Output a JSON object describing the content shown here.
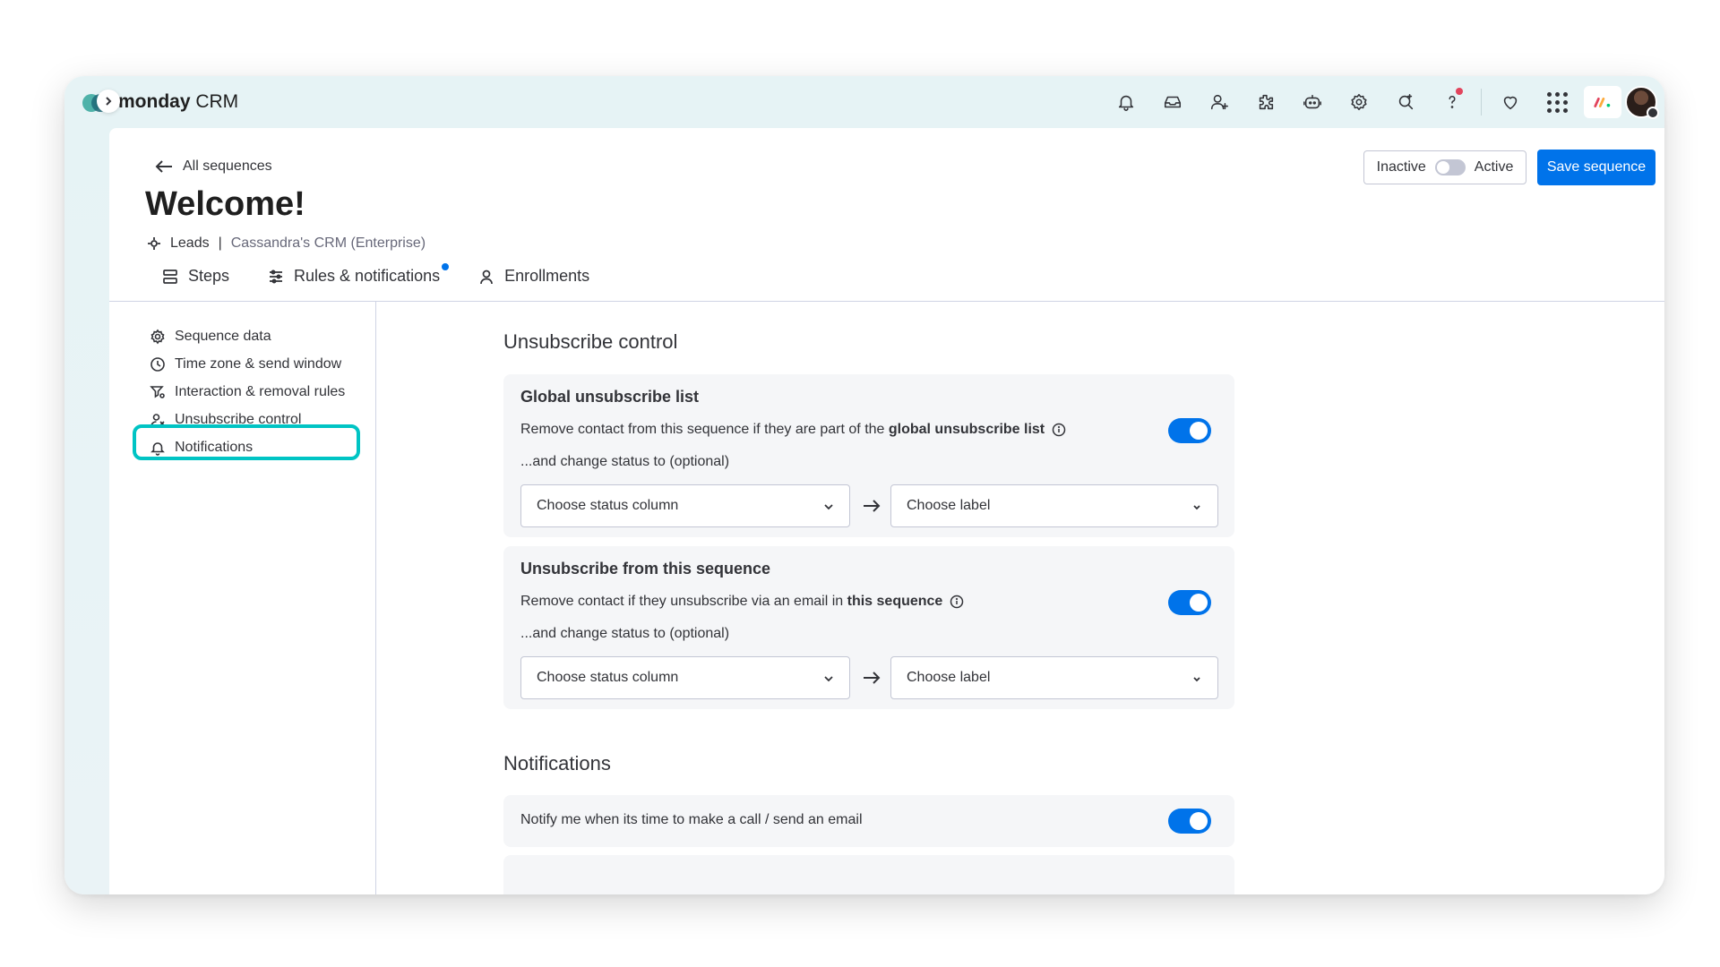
{
  "app": {
    "brand_bold": "monday",
    "brand_suffix": " CRM"
  },
  "topbar": {
    "icons": [
      "bell-icon",
      "inbox-icon",
      "invite-user-icon",
      "integrations-icon",
      "ai-bot-icon",
      "settings-icon",
      "search-icon",
      "help-icon",
      "heart-icon",
      "apps-grid-icon"
    ]
  },
  "header": {
    "back_label": "All sequences",
    "title": "Welcome!",
    "board": "Leads",
    "separator": "|",
    "workspace": "Cassandra's CRM (Enterprise)",
    "status_inactive": "Inactive",
    "status_active": "Active",
    "save_label": "Save sequence"
  },
  "tabs": [
    {
      "label": "Steps"
    },
    {
      "label": "Rules & notifications"
    },
    {
      "label": "Enrollments"
    }
  ],
  "sidenav": {
    "items": [
      {
        "label": "Sequence data"
      },
      {
        "label": "Time zone & send window"
      },
      {
        "label": "Interaction & removal rules"
      },
      {
        "label": "Unsubscribe control"
      },
      {
        "label": "Notifications"
      }
    ],
    "selected": "Unsubscribe control"
  },
  "unsubscribe": {
    "heading": "Unsubscribe control",
    "global": {
      "title": "Global unsubscribe list",
      "desc_prefix": "Remove contact from this sequence if they are part of the ",
      "desc_bold": "global unsubscribe list",
      "enabled": true,
      "optional_label": "...and change status to (optional)",
      "status_placeholder": "Choose status column",
      "label_placeholder": "Choose label"
    },
    "sequence": {
      "title": "Unsubscribe from this sequence",
      "desc_prefix": "Remove contact if they unsubscribe via an email in ",
      "desc_bold": "this sequence",
      "enabled": true,
      "optional_label": "...and change status to (optional)",
      "status_placeholder": "Choose status column",
      "label_placeholder": "Choose label"
    }
  },
  "notifications": {
    "heading": "Notifications",
    "items": [
      {
        "label": "Notify me when its time to make a call / send an email",
        "enabled": true
      }
    ]
  },
  "colors": {
    "accent": "#0073ea",
    "highlight": "#00c4c4",
    "alert": "#e2445c"
  }
}
